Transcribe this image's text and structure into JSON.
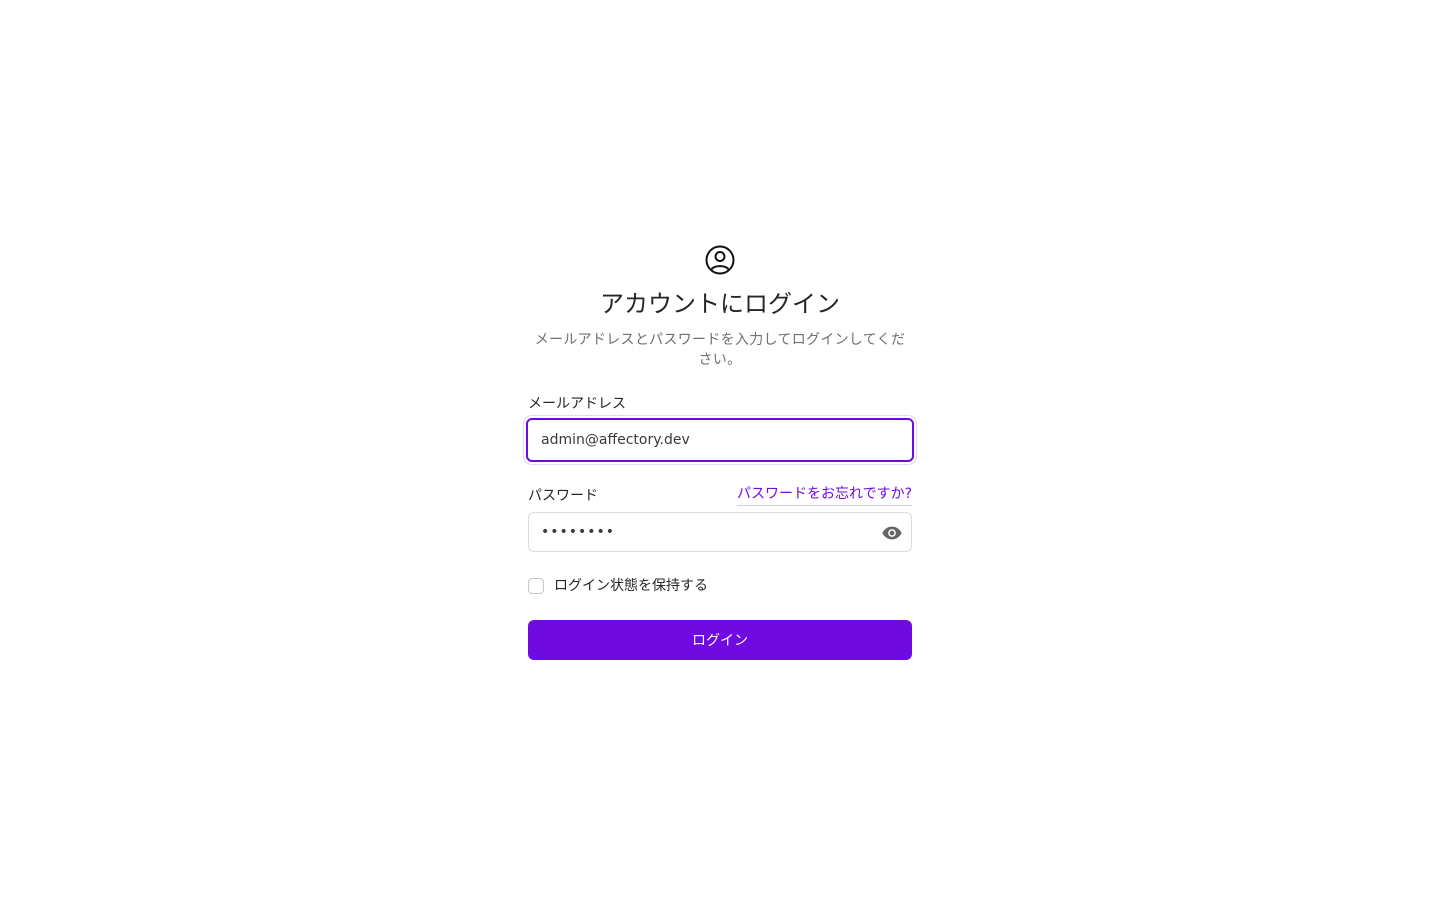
{
  "header": {
    "icon": "user-circle-icon",
    "title": "アカウントにログイン",
    "subtitle": "メールアドレスとパスワードを入力してログインしてください。"
  },
  "email": {
    "label": "メールアドレス",
    "value": "admin@affectory.dev"
  },
  "password": {
    "label": "パスワード",
    "forgot_link": "パスワードをお忘れですか?",
    "value": "••••••••",
    "toggle_icon": "eye-icon"
  },
  "remember": {
    "label": "ログイン状態を保持する",
    "checked": false
  },
  "submit": {
    "label": "ログイン"
  },
  "colors": {
    "accent": "#6f0ae0",
    "text": "#262626",
    "muted": "#707070"
  }
}
